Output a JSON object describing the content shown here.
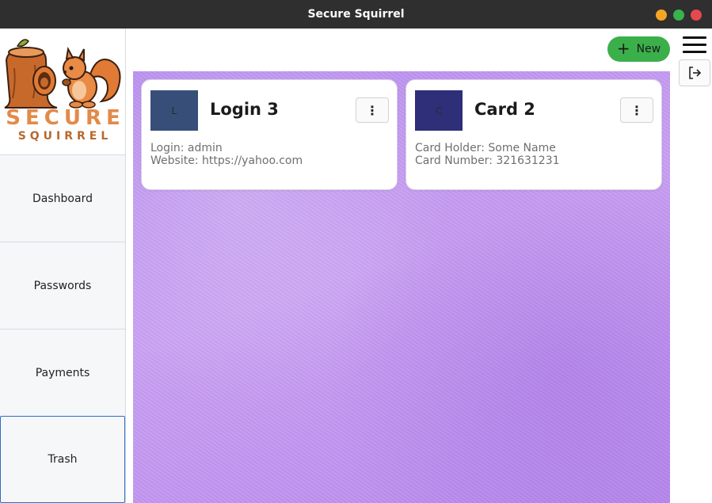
{
  "window": {
    "title": "Secure Squirrel"
  },
  "logo": {
    "line1": "SECURE",
    "line2": "SQUIRREL"
  },
  "sidebar": {
    "items": [
      {
        "label": "Dashboard"
      },
      {
        "label": "Passwords"
      },
      {
        "label": "Payments"
      },
      {
        "label": "Trash"
      }
    ]
  },
  "toolbar": {
    "new_label": "New",
    "new_icon": "plus-icon",
    "menu_icon": "hamburger-icon",
    "logout_icon": "logout-icon",
    "new_color": "#3bb04a"
  },
  "cards": [
    {
      "avatar_letter": "L",
      "avatar_color": "#374f78",
      "title": "Login 3",
      "menu_icon": "more-vertical-icon",
      "lines": [
        "Login: admin",
        "Website: https://yahoo.com"
      ]
    },
    {
      "avatar_letter": "C",
      "avatar_color": "#2e2f78",
      "title": "Card 2",
      "menu_icon": "more-vertical-icon",
      "lines": [
        "Card Holder: Some Name",
        "Card Number: 321631231"
      ]
    }
  ]
}
